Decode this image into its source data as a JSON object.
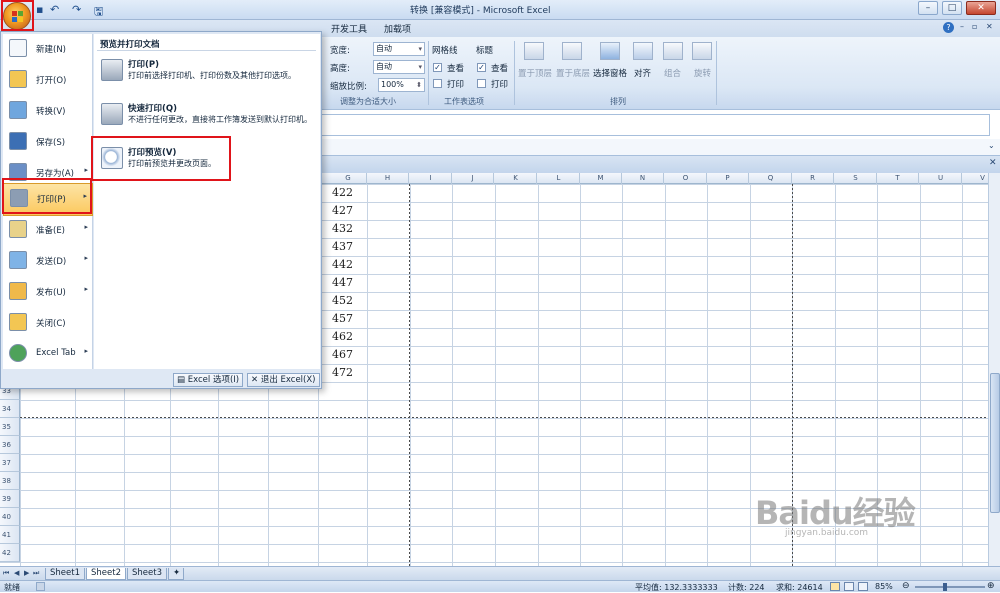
{
  "window": {
    "title": "转换 [兼容模式] - Microsoft Excel",
    "qat_items": [
      "↶",
      "↷",
      "🖫"
    ],
    "controls": [
      "–",
      "□",
      "✕"
    ]
  },
  "ribbon": {
    "tabs": [
      "开发工具",
      "加载项"
    ],
    "help": "?",
    "scale_group": {
      "width_label": "宽度:",
      "width_value": "自动",
      "height_label": "高度:",
      "height_value": "自动",
      "scale_label": "缩放比例:",
      "scale_value": "100%",
      "caption": "调整为合适大小"
    },
    "sheet_options_group": {
      "gridlines_label": "网格线",
      "headings_label": "标题",
      "view_label": "查看",
      "print_label": "打印",
      "gridlines_view": true,
      "gridlines_print": false,
      "headings_view": true,
      "headings_print": false,
      "caption": "工作表选项"
    },
    "arrange_group": {
      "buttons": [
        "置于顶层",
        "置于底层",
        "选择窗格",
        "对齐",
        "组合",
        "旋转"
      ],
      "caption": "排列"
    }
  },
  "grid": {
    "columns": [
      "G",
      "H",
      "I",
      "J",
      "K",
      "L",
      "M",
      "N",
      "O",
      "P",
      "Q",
      "R",
      "S",
      "T",
      "U",
      "V"
    ],
    "rows": [
      "33",
      "34",
      "35",
      "36",
      "37",
      "38",
      "39",
      "40",
      "41",
      "42"
    ],
    "g_values": [
      "422",
      "427",
      "432",
      "437",
      "442",
      "447",
      "452",
      "457",
      "462",
      "467",
      "472"
    ]
  },
  "office_menu": {
    "left_items": [
      {
        "label": "新建(N)",
        "icon": "new-document-icon",
        "submenu": false
      },
      {
        "label": "打开(O)",
        "icon": "open-folder-icon",
        "submenu": false
      },
      {
        "label": "转换(V)",
        "icon": "convert-icon",
        "submenu": false
      },
      {
        "label": "保存(S)",
        "icon": "save-icon",
        "submenu": false
      },
      {
        "label": "另存为(A)",
        "icon": "save-as-icon",
        "submenu": true
      },
      {
        "label": "打印(P)",
        "icon": "printer-icon",
        "submenu": true
      },
      {
        "label": "准备(E)",
        "icon": "prepare-icon",
        "submenu": true
      },
      {
        "label": "发送(D)",
        "icon": "send-icon",
        "submenu": true
      },
      {
        "label": "发布(U)",
        "icon": "publish-icon",
        "submenu": true
      },
      {
        "label": "关闭(C)",
        "icon": "close-folder-icon",
        "submenu": false
      },
      {
        "label": "Excel Tab",
        "icon": "excel-tab-icon",
        "submenu": true
      }
    ],
    "right_title": "预览并打印文档",
    "right_items": [
      {
        "title": "打印(P)",
        "desc": "打印前选择打印机、打印份数及其他打印选项。",
        "icon": "printer-icon"
      },
      {
        "title": "快速打印(Q)",
        "desc": "不进行任何更改，直接将工作簿发送到默认打印机。",
        "icon": "quick-print-icon"
      },
      {
        "title": "打印预览(V)",
        "desc": "打印前预览并更改页面。",
        "icon": "print-preview-icon"
      }
    ],
    "footer": {
      "options": "Excel 选项(I)",
      "exit": "退出 Excel(X)"
    }
  },
  "sheets": [
    "Sheet1",
    "Sheet2",
    "Sheet3"
  ],
  "active_sheet": "Sheet2",
  "status": {
    "ready": "就绪",
    "average": "平均值: 132.3333333",
    "count": "计数: 224",
    "sum": "求和: 24614",
    "zoom": "85%"
  },
  "watermark": {
    "main": "Baidu经验",
    "sub": "jingyan.baidu.com"
  },
  "colors": {
    "highlight_red": "#e0141a",
    "menu_hover": "#fbc85d",
    "office_orange": "#f09a22"
  }
}
